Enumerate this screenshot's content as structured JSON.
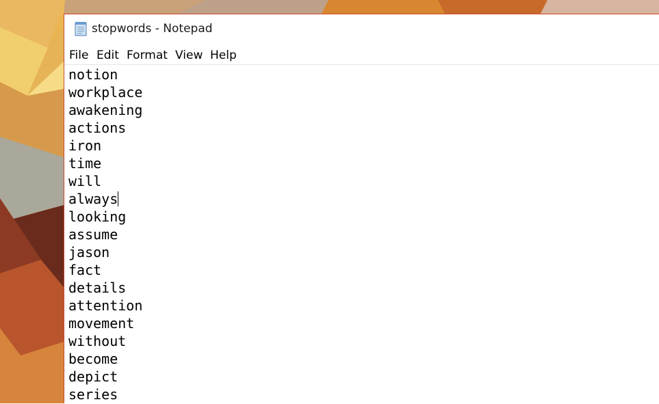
{
  "window": {
    "title": "stopwords - Notepad"
  },
  "icons": {
    "app": "notepad-icon"
  },
  "menu": [
    {
      "label": "File"
    },
    {
      "label": "Edit"
    },
    {
      "label": "Format"
    },
    {
      "label": "View"
    },
    {
      "label": "Help"
    }
  ],
  "document": {
    "lines": [
      "notion",
      "workplace",
      "awakening",
      "actions",
      "iron",
      "time",
      "will",
      "always",
      "looking",
      "assume",
      "jason",
      "fact",
      "details",
      "attention",
      "movement",
      "without",
      "become",
      "depict",
      "series"
    ],
    "caret_line": 7
  },
  "colors": {
    "window_border": "#c94a2c",
    "text": "#000000",
    "desktop_warm": "#d9923a"
  }
}
